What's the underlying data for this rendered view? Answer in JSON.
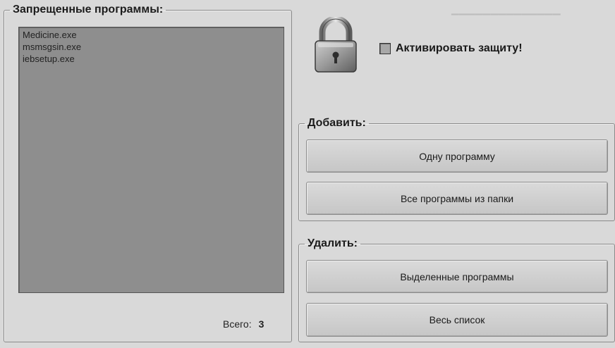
{
  "forbidden_panel": {
    "title": "Запрещенные программы:",
    "items": [
      "Medicine.exe",
      "msmsgsin.exe",
      "iebsetup.exe"
    ],
    "total_label": "Всего:",
    "total_value": "3"
  },
  "protection": {
    "checkbox_label": "Активировать защиту!",
    "checked": false
  },
  "add_group": {
    "title": "Добавить:",
    "one_program": "Одну программу",
    "all_from_folder": "Все программы из папки"
  },
  "remove_group": {
    "title": "Удалить:",
    "selected": "Выделенные программы",
    "whole_list": "Весь список"
  },
  "icons": {
    "lock": "padlock-icon"
  },
  "colors": {
    "window": "#d9d9d9",
    "listbox": "#8e8e8e",
    "button": "#d0d0d0"
  }
}
